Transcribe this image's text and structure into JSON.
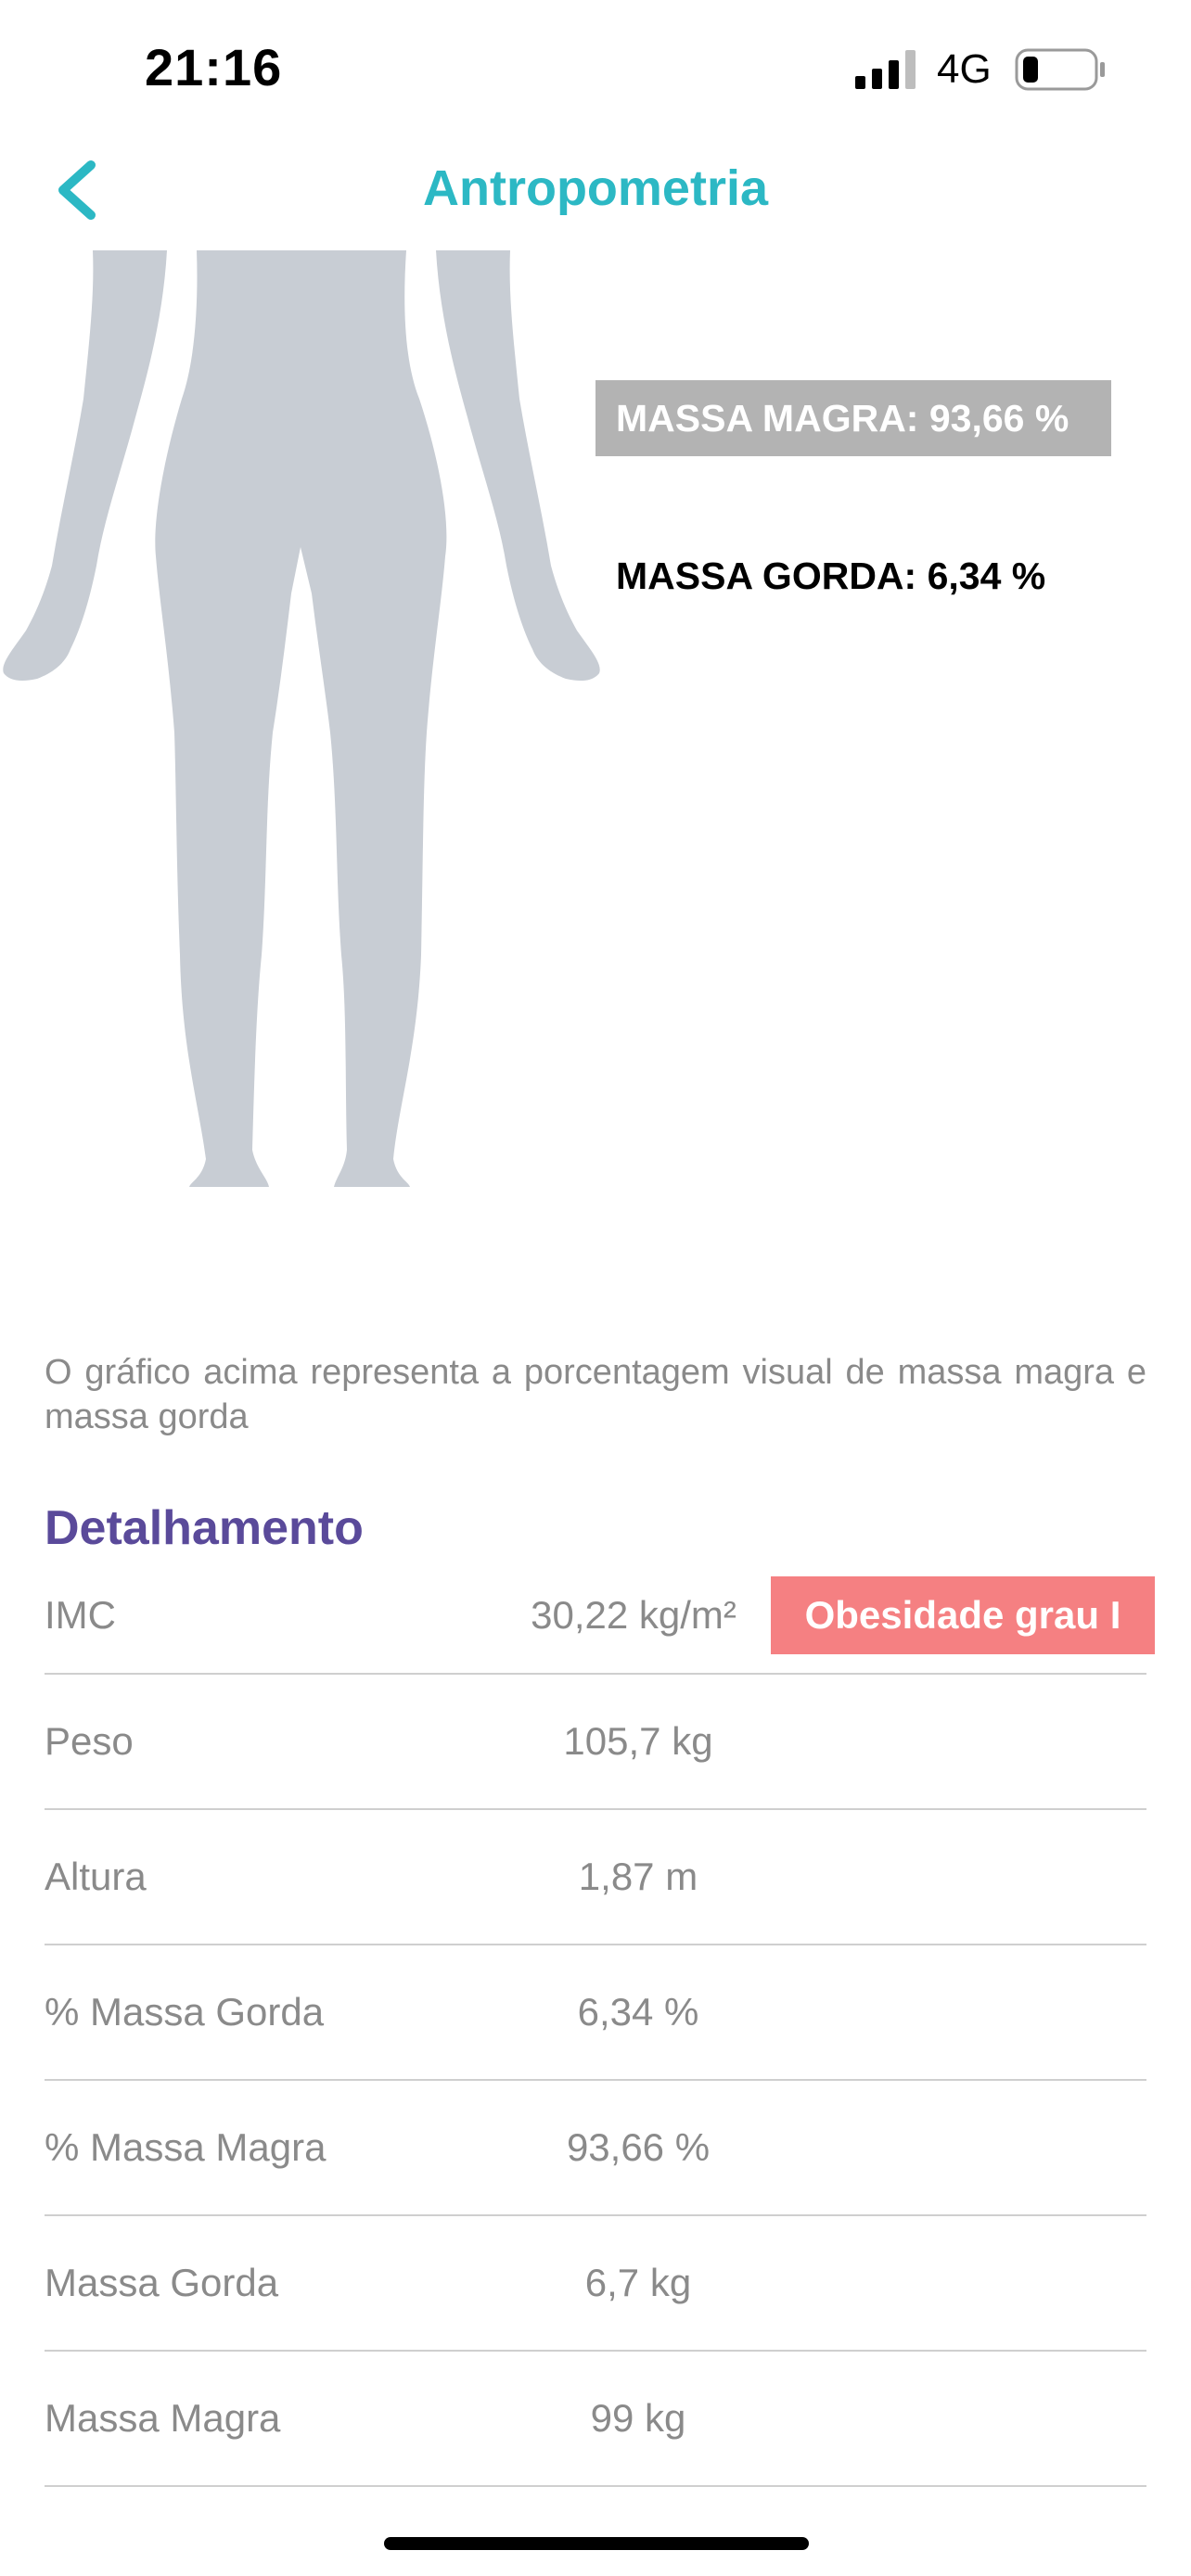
{
  "status_bar": {
    "time": "21:16",
    "network": "4G",
    "icons": [
      "signal-icon",
      "battery-icon"
    ]
  },
  "nav": {
    "title": "Antropometria",
    "back_icon": "chevron-left-icon",
    "accent_color": "#2cb8c4"
  },
  "body_chart": {
    "lean_label": "MASSA MAGRA: 93,66 %",
    "fat_label": "MASSA GORDA: 6,34 %",
    "figure_color": "#c8cdd4",
    "lean_label_bg": "#b3b3b3"
  },
  "caption": "O gráfico acima representa a porcentagem visual de massa magra e massa gorda",
  "details": {
    "title": "Detalhamento",
    "title_color": "#5a4a9a",
    "rows": [
      {
        "label": "IMC",
        "value": "30,22 kg/m²",
        "badge": "Obesidade grau I",
        "badge_color": "#f58082"
      },
      {
        "label": "Peso",
        "value": "105,7 kg"
      },
      {
        "label": "Altura",
        "value": "1,87 m"
      },
      {
        "label": "% Massa Gorda",
        "value": "6,34 %"
      },
      {
        "label": "% Massa Magra",
        "value": "93,66 %"
      },
      {
        "label": "Massa Gorda",
        "value": "6,7 kg"
      },
      {
        "label": "Massa Magra",
        "value": "99 kg"
      }
    ]
  }
}
